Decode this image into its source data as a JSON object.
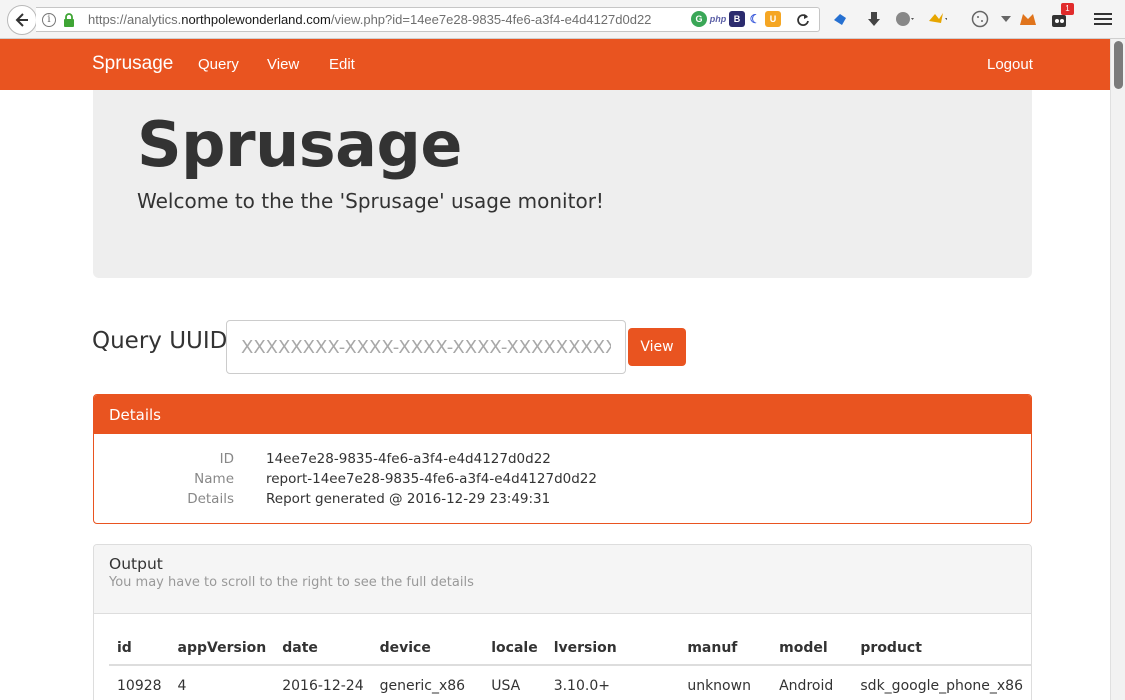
{
  "browser": {
    "url_prefix": "https://analytics.",
    "url_domain": "northpolewonderland.com",
    "url_path": "/view.php?id=14ee7e28-9835-4fe6-a3f4-e4d4127d0d22",
    "badge_count": "1"
  },
  "navbar": {
    "brand": "Sprusage",
    "links": [
      "Query",
      "View",
      "Edit"
    ],
    "logout": "Logout",
    "accent_color": "#e95420"
  },
  "jumbotron": {
    "title": "Sprusage",
    "subtitle": "Welcome to the the 'Sprusage' usage monitor!"
  },
  "query": {
    "label": "Query UUID",
    "placeholder": "XXXXXXXX-XXXX-XXXX-XXXX-XXXXXXXXXX",
    "button": "View"
  },
  "details": {
    "heading": "Details",
    "rows": [
      {
        "key": "ID",
        "value": "14ee7e28-9835-4fe6-a3f4-e4d4127d0d22"
      },
      {
        "key": "Name",
        "value": "report-14ee7e28-9835-4fe6-a3f4-e4d4127d0d22"
      },
      {
        "key": "Details",
        "value": "Report generated @ 2016-12-29 23:49:31"
      }
    ]
  },
  "output": {
    "title": "Output",
    "subtitle": "You may have to scroll to the right to see the full details",
    "columns": [
      "id",
      "appVersion",
      "date",
      "device",
      "locale",
      "lversion",
      "manuf",
      "model",
      "product"
    ],
    "rows": [
      [
        "10928",
        "4",
        "2016-12-24",
        "generic_x86",
        "USA",
        "3.10.0+",
        "unknown",
        "Android",
        "sdk_google_phone_x86"
      ]
    ]
  }
}
